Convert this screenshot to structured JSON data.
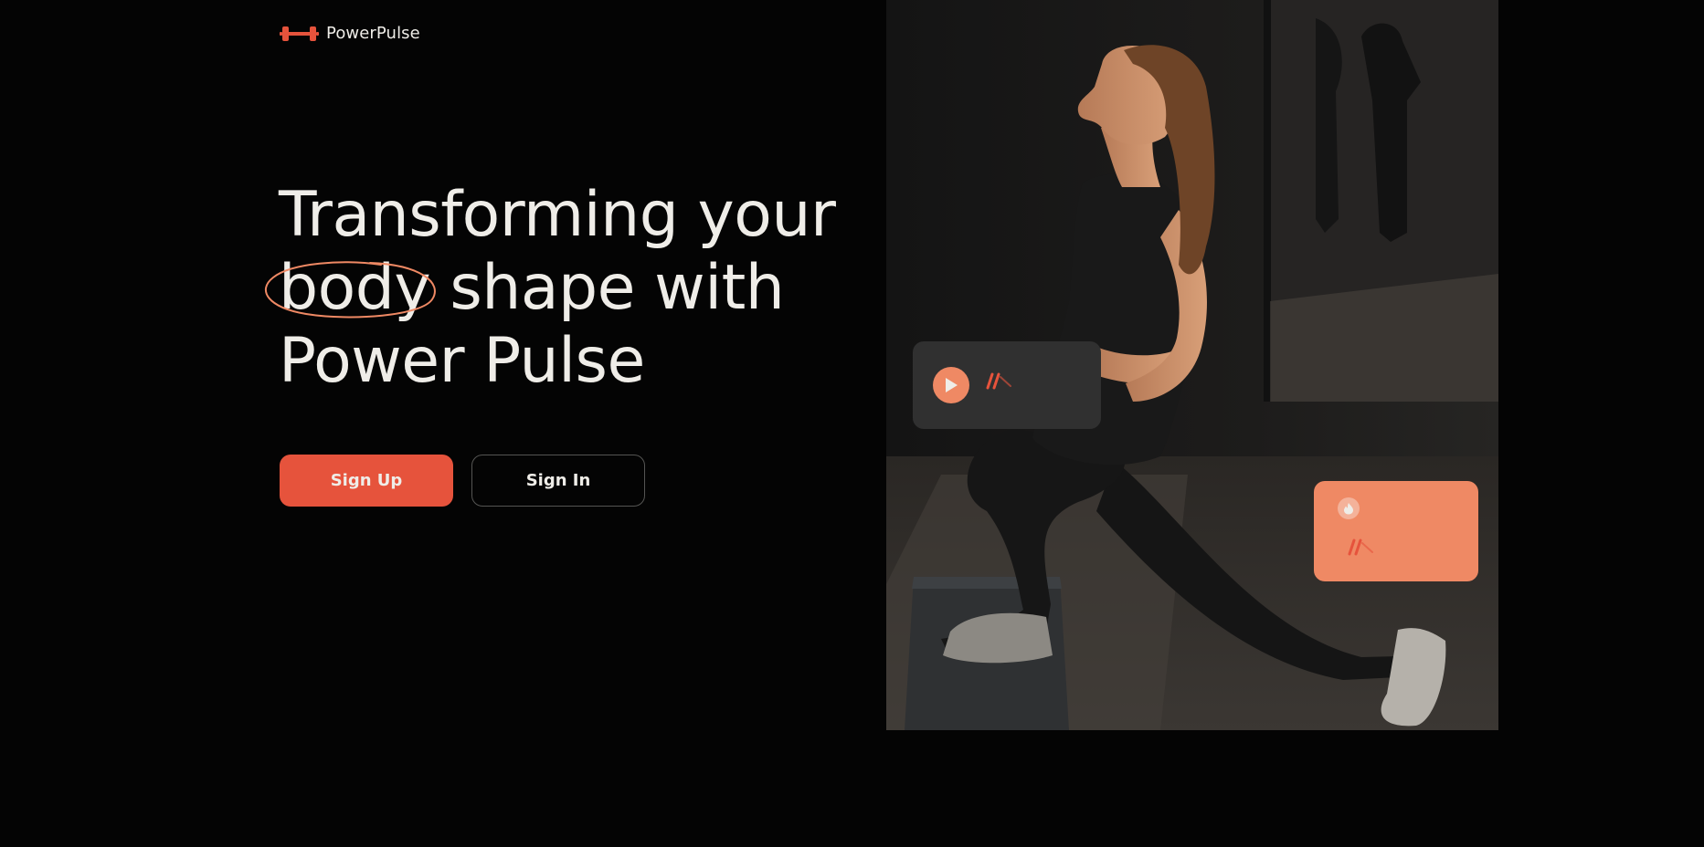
{
  "brand": {
    "name": "PowerPulse",
    "logo_icon": "dumbbell-icon",
    "accent_color": "#e6533c",
    "secondary_color": "#ef8964",
    "text_color": "#efede8",
    "background_color": "#040404"
  },
  "hero": {
    "title_line1": "Transforming your",
    "title_highlight": "body",
    "title_line2_rest": "shape with",
    "title_line3": "Power Pulse"
  },
  "actions": {
    "signup_label": "Sign Up",
    "signin_label": "Sign In"
  },
  "cards": {
    "video_card_icon": "play-icon",
    "calories_card_icon": "flame-icon"
  }
}
